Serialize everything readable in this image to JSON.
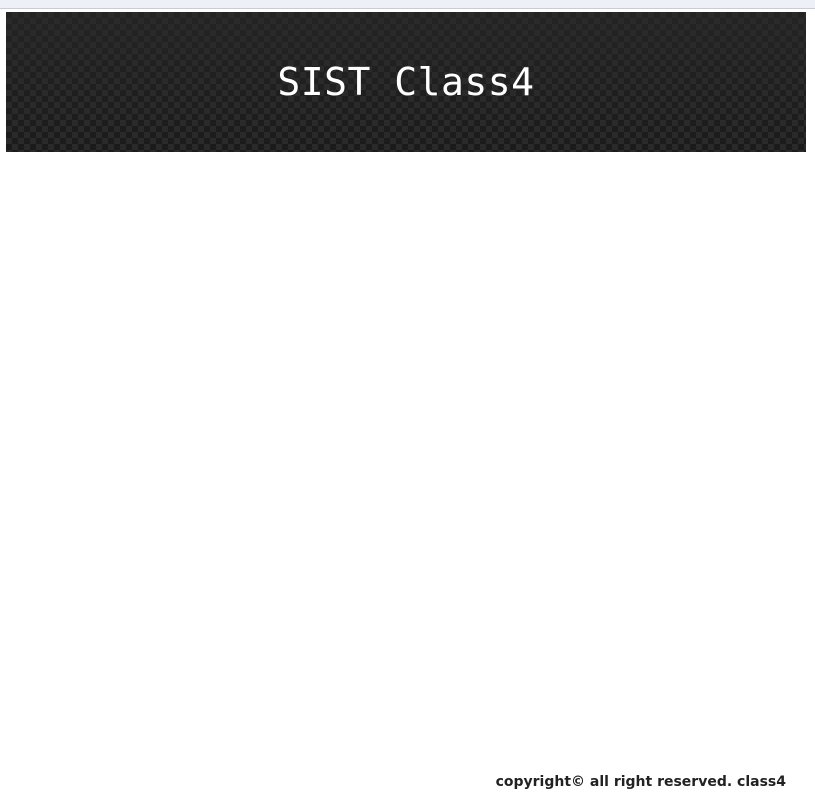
{
  "header": {
    "title": "SIST Class4",
    "background_color": "#1d1d1d",
    "title_color": "#ffffff"
  },
  "footer": {
    "text": "copyright© all right reserved. class4"
  }
}
